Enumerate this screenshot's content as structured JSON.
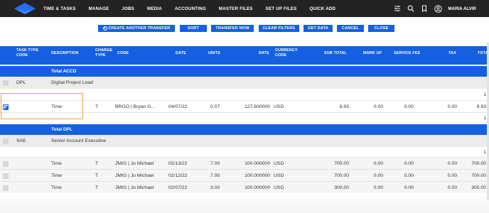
{
  "nav": {
    "items": [
      "TIME & TASKS",
      "MANAGE",
      "JOBS",
      "MEDIA",
      "ACCOUNTING",
      "MASTER FILES",
      "SET UP FILES",
      "QUICK ADD"
    ],
    "user_name": "MARIA ALVIR",
    "icons": [
      "sliders-icon",
      "search-icon",
      "bookmark-icon",
      "user-icon"
    ]
  },
  "toolbar": {
    "create_label": "CREATE ANOTHER TRANSFER",
    "sort_label": "SORT",
    "transfer_label": "TRANSFER NOW",
    "clear_label": "CLEAR FILTERS",
    "get_data_label": "GET DATA",
    "cancel_label": "CANCEL",
    "close_label": "CLOSE"
  },
  "table": {
    "headers": {
      "task_type_code": [
        "TASK TYPE",
        "CODE"
      ],
      "description": "DESCRIPTION",
      "charge_type": [
        "CHARGE",
        "TYPE"
      ],
      "code": "CODE",
      "date": "DATE",
      "units": "UNITS",
      "rate": "RATE",
      "currency_code": [
        "CURRENCY",
        "CODE"
      ],
      "sub_total": "SUB TOTAL",
      "mark_up": "MARK UP",
      "service_fee": "SERVICE FEE",
      "tax": "TAX",
      "total": "TOTA"
    },
    "sections": [
      {
        "total_label": "Total ACCD",
        "group_code": "DPL",
        "group_desc": "Digital Project Lead",
        "count": "1",
        "rows": [
          {
            "description": "Time",
            "charge_type": "T",
            "code": "BRGO | Bryan G...",
            "date": "04/07/22",
            "units": "0.07",
            "rate": "127.600000",
            "currency": "USD",
            "sub_total": "8.93",
            "mark_up": "0.00",
            "service_fee": "0.00",
            "tax": "0.00",
            "total": "8.93",
            "checked": true
          }
        ],
        "footer_count": "1"
      },
      {
        "total_label": "Total DPL",
        "group_code": "SAE",
        "group_desc": "Senior Account Executive",
        "count": "1",
        "rows": [
          {
            "description": "Time",
            "charge_type": "T",
            "code": "JMIG | Jo Michael",
            "date": "02/13/22",
            "units": "7.00",
            "rate": "100.000000",
            "currency": "USD",
            "sub_total": "700.00",
            "mark_up": "0.00",
            "service_fee": "0.00",
            "tax": "0.00",
            "total": "700.00",
            "checked": false
          },
          {
            "description": "Time",
            "charge_type": "T",
            "code": "JMIG | Jo Michael",
            "date": "02/12/22",
            "units": "7.00",
            "rate": "100.000000",
            "currency": "USD",
            "sub_total": "700.00",
            "mark_up": "0.00",
            "service_fee": "0.00",
            "tax": "0.00",
            "total": "700.00",
            "checked": false
          },
          {
            "description": "Time",
            "charge_type": "T",
            "code": "JMIG | Jo Michael",
            "date": "02/07/22",
            "units": "3.00",
            "rate": "100.000000",
            "currency": "USD",
            "sub_total": "300.00",
            "mark_up": "0.00",
            "service_fee": "0.00",
            "tax": "0.00",
            "total": "300.00",
            "checked": false
          }
        ]
      }
    ]
  },
  "colors": {
    "accent": "#1560e0",
    "topbar": "#232323",
    "highlight": "#f0a43a"
  }
}
